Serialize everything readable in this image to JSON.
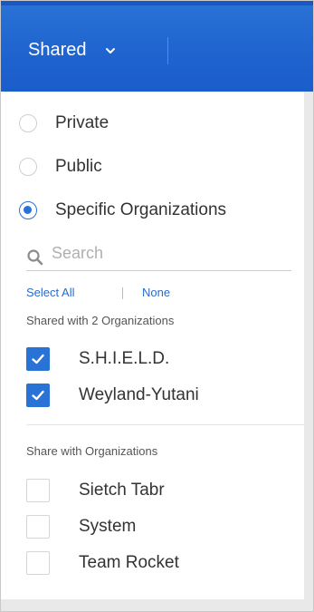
{
  "header": {
    "dropdown_label": "Shared"
  },
  "visibility": {
    "options": [
      {
        "label": "Private",
        "checked": false
      },
      {
        "label": "Public",
        "checked": false
      },
      {
        "label": "Specific Organizations",
        "checked": true
      }
    ]
  },
  "search": {
    "placeholder": "Search",
    "value": ""
  },
  "bulk": {
    "select_all": "Select All",
    "none": "None"
  },
  "shared": {
    "heading": "Shared with 2 Organizations",
    "items": [
      {
        "label": "S.H.I.E.L.D.",
        "checked": true
      },
      {
        "label": "Weyland-Yutani",
        "checked": true
      }
    ]
  },
  "available": {
    "heading": "Share with Organizations",
    "items": [
      {
        "label": "Sietch Tabr",
        "checked": false
      },
      {
        "label": "System",
        "checked": false
      },
      {
        "label": "Team Rocket",
        "checked": false
      }
    ]
  },
  "colors": {
    "accent": "#2a73d6",
    "link": "#2a6cc9"
  }
}
